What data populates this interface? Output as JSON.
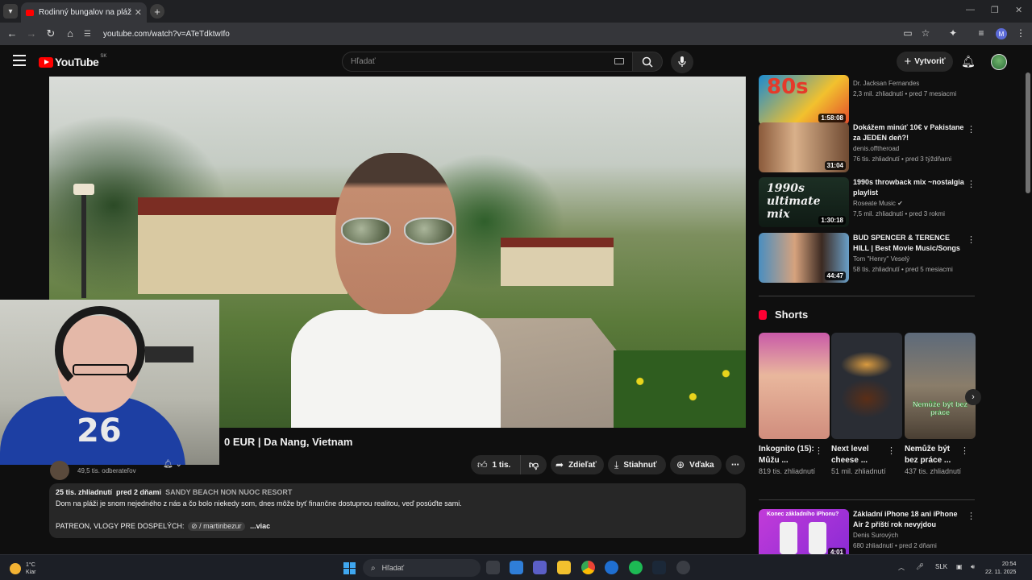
{
  "browser": {
    "tab_title": "Rodinný bungalov na pláži len",
    "tab_close": "✕",
    "new_tab": "+",
    "url": "youtube.com/watch?v=ATeTdktwIfo",
    "profile_initial": "M",
    "window_controls": [
      "—",
      "❐",
      "✕"
    ]
  },
  "youtube": {
    "logo_text": "YouTube",
    "country_code": "SK",
    "search_placeholder": "Hľadať",
    "create_label": "Vytvoriť"
  },
  "video": {
    "title_visible": "0 EUR | Da Nang, Vietnam",
    "subscribers": "49,5 tis. odberateľov",
    "like_count": "1 tis.",
    "share_label": "Zdieľať",
    "download_label": "Stiahnuť",
    "thanks_label": "Vďaka",
    "webcam_shirt_number": "26"
  },
  "description": {
    "views": "25 tis. zhliadnutí",
    "age": "pred 2 dňami",
    "location_tag": "SANDY BEACH NON NUOC RESORT",
    "text": "Dom na pláži je snom nejedného z nás a čo bolo niekedy som, dnes môže byť finančne dostupnou realitou, veď posúďte sami.",
    "patreon_label": "PATREON, VLOGY PRE DOSPELÝCH:",
    "patreon_chip": "/ martinbezur",
    "more_label": "...viac"
  },
  "recommendations": [
    {
      "title": "",
      "channel": "Dr. Jacksan Fernandes",
      "stats": "2,3 mil. zhliadnutí • pred 7 mesiacmi",
      "duration": "1:58:08",
      "thumb_text": "80s"
    },
    {
      "title": "Dokážem minúť 10€ v Pakistane za JEDEN deň?!",
      "channel": "denis.offtheroad",
      "stats": "76 tis. zhliadnutí • pred 3 týždňami",
      "duration": "31:04",
      "thumb_text": ""
    },
    {
      "title": "1990s throwback mix ~nostalgia playlist",
      "channel": "Roseate Music",
      "stats": "7,5 mil. zhliadnutí • pred 3 rokmi",
      "duration": "1:30:18",
      "thumb_text": "1990s ultimate mix"
    },
    {
      "title": "BUD SPENCER & TERENCE HILL | Best Movie Music/Songs",
      "channel": "Tom \"Henry\" Veselý",
      "stats": "58 tis. zhliadnutí • pred 5 mesiacmi",
      "duration": "44:47",
      "thumb_text": ""
    },
    {
      "title": "Základní iPhone 18 ani iPhone Air 2 příští rok nevyjdou",
      "channel": "Denis Surových",
      "stats": "680 zhliadnutí • pred 2 dňami",
      "duration": "4:01",
      "thumb_text": "Konec základního iPhonu?"
    }
  ],
  "shorts": {
    "heading": "Shorts",
    "items": [
      {
        "title": "Inkognito (15): Můžu ...",
        "views": "819 tis. zhliadnutí"
      },
      {
        "title": "Next level cheese ...",
        "views": "51 mil. zhliadnutí"
      },
      {
        "title": "Nemůže být bez práce ...",
        "views": "437 tis. zhliadnutí",
        "thumb_text": "Nemůže být bez práce"
      }
    ]
  },
  "taskbar": {
    "temp": "1°C",
    "weather": "Kiar",
    "search_placeholder": "Hľadať",
    "lang": "SLK",
    "time": "20:54",
    "date": "22. 11. 2025"
  },
  "colors": {
    "youtube_red": "#ff0000",
    "background": "#0f0f0f",
    "pill_bg": "#272727"
  }
}
